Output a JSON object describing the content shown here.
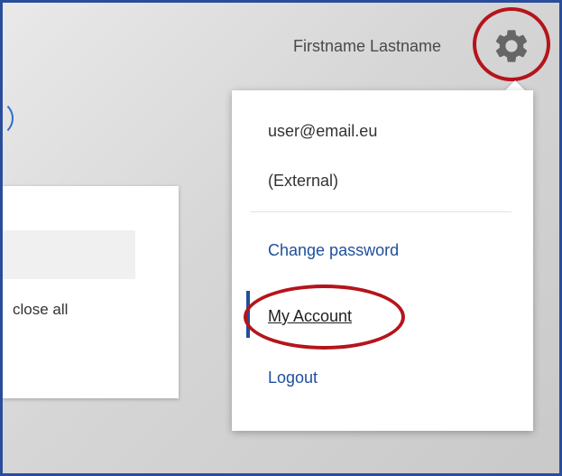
{
  "header": {
    "user_name": "Firstname Lastname",
    "settings_icon": "gear-icon"
  },
  "background_card": {
    "text": "close all"
  },
  "dropdown": {
    "email": "user@email.eu",
    "account_type": "(External)",
    "items": [
      {
        "label": "Change password",
        "active": false
      },
      {
        "label": "My Account",
        "active": true
      },
      {
        "label": "Logout",
        "active": false
      }
    ]
  },
  "colors": {
    "frame_border": "#2a4d9b",
    "link": "#1f4f9c",
    "highlight": "#b5141b",
    "gear": "#666666"
  }
}
